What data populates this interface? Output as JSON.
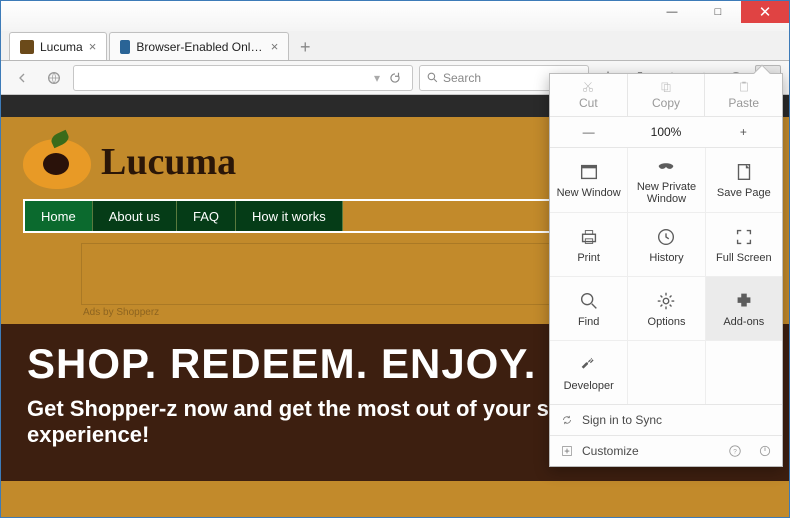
{
  "window": {
    "minimize": "—",
    "maximize": "□",
    "close": "✕"
  },
  "tabs": [
    {
      "label": "Lucuma",
      "active": true
    },
    {
      "label": "Browser-Enabled Online Advert...",
      "active": false
    }
  ],
  "toolbar": {
    "url_value": "",
    "search_placeholder": "Search"
  },
  "menu": {
    "cut": "Cut",
    "copy": "Copy",
    "paste": "Paste",
    "zoom_minus": "—",
    "zoom_value": "100%",
    "zoom_plus": "+",
    "items": {
      "new_window": "New Window",
      "new_private": "New Private Window",
      "save_page": "Save Page",
      "print": "Print",
      "history": "History",
      "full_screen": "Full Screen",
      "find": "Find",
      "options": "Options",
      "addons": "Add-ons",
      "developer": "Developer"
    },
    "sign_in": "Sign in to Sync",
    "customize": "Customize"
  },
  "page": {
    "brand": "Lucuma",
    "nav": [
      "Home",
      "About us",
      "FAQ",
      "How it works"
    ],
    "ad_note": "Ads by Shopperz",
    "hero_title": "SHOP. REDEEM. ENJOY.",
    "hero_sub": "Get Shopper-z now and get the most out of your shopping experience!"
  }
}
